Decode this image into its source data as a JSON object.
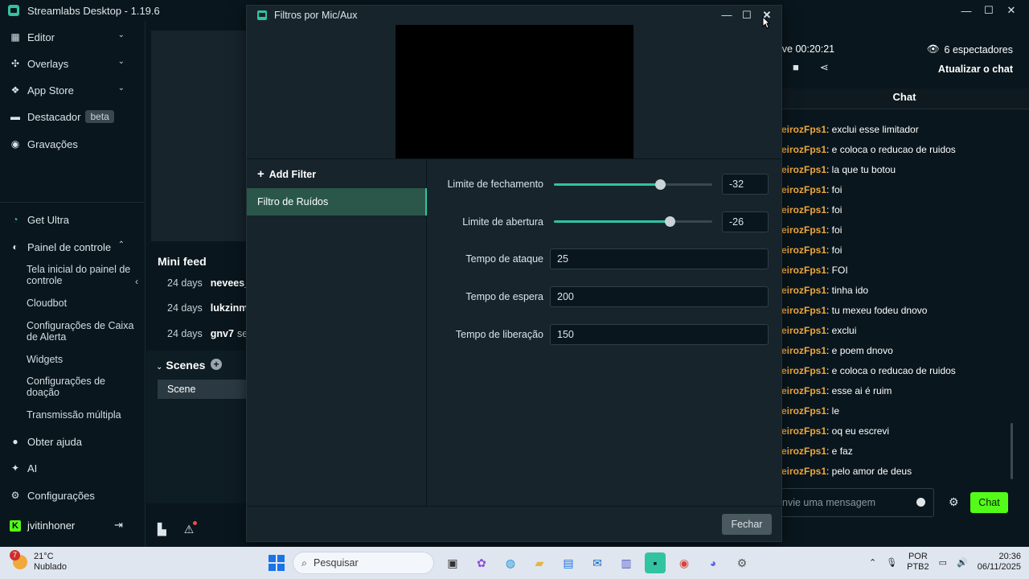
{
  "app": {
    "title": "Streamlabs Desktop - 1.19.6"
  },
  "window_controls": {
    "minimize": "—",
    "maximize": "☐",
    "close": "✕"
  },
  "sidebar": {
    "items": [
      {
        "label": "Editor",
        "icon": "editor-icon",
        "chevron": "⌄"
      },
      {
        "label": "Overlays",
        "icon": "overlays-icon",
        "chevron": "⌄"
      },
      {
        "label": "App Store",
        "icon": "app-store-icon",
        "chevron": "⌄"
      },
      {
        "label": "Destacador",
        "icon": "highlighter-icon",
        "badge": "beta"
      },
      {
        "label": "Gravações",
        "icon": "recordings-icon"
      },
      {
        "label": "Get Ultra",
        "icon": "ultra-icon"
      },
      {
        "label": "Painel de controle",
        "icon": "dashboard-icon",
        "chevron": "⌃"
      }
    ],
    "dashboard_subitems": [
      "Tela inicial do painel de controle",
      "Cloudbot",
      "Configurações de Caixa de Alerta",
      "Widgets",
      "Configurações de doação",
      "Transmissão múltipla"
    ],
    "bottom_items": [
      {
        "label": "Obter ajuda",
        "icon": "help-icon"
      },
      {
        "label": "AI",
        "icon": "ai-sparkle-icon"
      },
      {
        "label": "Configurações",
        "icon": "settings-gear-icon"
      }
    ],
    "user": {
      "name": "jvitinhoner",
      "logout_icon": "⇥"
    }
  },
  "mini_feed": {
    "title": "Mini feed",
    "collapse_arrow": "‹",
    "rows": [
      {
        "age": "24 days",
        "user": "nevees_j",
        "rest": ""
      },
      {
        "age": "24 days",
        "user": "lukzinmo",
        "rest": ""
      },
      {
        "age": "24 days",
        "user": "gnv7",
        "rest": "se"
      }
    ]
  },
  "scenes": {
    "title": "Scenes",
    "collapse": "⌄",
    "add": "+",
    "items": [
      "Scene"
    ]
  },
  "stream_info": {
    "live_time": "ive 00:20:21",
    "viewers": "6 espectadores",
    "refresh_chat": "Atualizar o chat"
  },
  "chat": {
    "header": "Chat",
    "messages": [
      {
        "user": "eirozFps1",
        "text": ": exclui esse limitador"
      },
      {
        "user": "eirozFps1",
        "text": ": e coloca o reducao de ruidos"
      },
      {
        "user": "eirozFps1",
        "text": ": la que tu botou"
      },
      {
        "user": "eirozFps1",
        "text": ": foi"
      },
      {
        "user": "eirozFps1",
        "text": ": foi"
      },
      {
        "user": "eirozFps1",
        "text": ": foi"
      },
      {
        "user": "eirozFps1",
        "text": ": foi"
      },
      {
        "user": "eirozFps1",
        "text": ": FOI"
      },
      {
        "user": "eirozFps1",
        "text": ": tinha ido"
      },
      {
        "user": "eirozFps1",
        "text": ": tu mexeu fodeu dnovo"
      },
      {
        "user": "eirozFps1",
        "text": ": exclui"
      },
      {
        "user": "eirozFps1",
        "text": ": e poem dnovo"
      },
      {
        "user": "eirozFps1",
        "text": ": e coloca o reducao de ruidos"
      },
      {
        "user": "eirozFps1",
        "text": ": esse ai é ruim"
      },
      {
        "user": "eirozFps1",
        "text": ": le"
      },
      {
        "user": "eirozFps1",
        "text": ": oq eu escrevi"
      },
      {
        "user": "eirozFps1",
        "text": ": e faz"
      },
      {
        "user": "eirozFps1",
        "text": ": pelo amor de deus"
      }
    ],
    "input_placeholder": "nvie uma mensagem",
    "send_label": "Chat"
  },
  "modal": {
    "title": "Filtros por Mic/Aux",
    "add_filter": "Add Filter",
    "filters": [
      "Filtro de Ruídos"
    ],
    "sliders": [
      {
        "label": "Limite de fechamento",
        "value": "-32",
        "fill_fraction": 0.67
      },
      {
        "label": "Limite de abertura",
        "value": "-26",
        "fill_fraction": 0.73
      }
    ],
    "fields": [
      {
        "label": "Tempo de ataque",
        "value": "25"
      },
      {
        "label": "Tempo de espera",
        "value": "200"
      },
      {
        "label": "Tempo de liberação",
        "value": "150"
      }
    ],
    "close_button": "Fechar"
  },
  "taskbar": {
    "weather": {
      "temp": "21°C",
      "condition": "Nublado",
      "badge": "7"
    },
    "search_placeholder": "Pesquisar",
    "tray": {
      "lang_top": "POR",
      "lang_bottom": "PTB2",
      "time": "20:36",
      "date": "06/11/2025"
    }
  },
  "colors": {
    "accent": "#31c3a2",
    "chat_username": "#f1a83c",
    "chat_send": "#53fc18",
    "background": "#09161d",
    "modal_bg": "#17242c"
  }
}
